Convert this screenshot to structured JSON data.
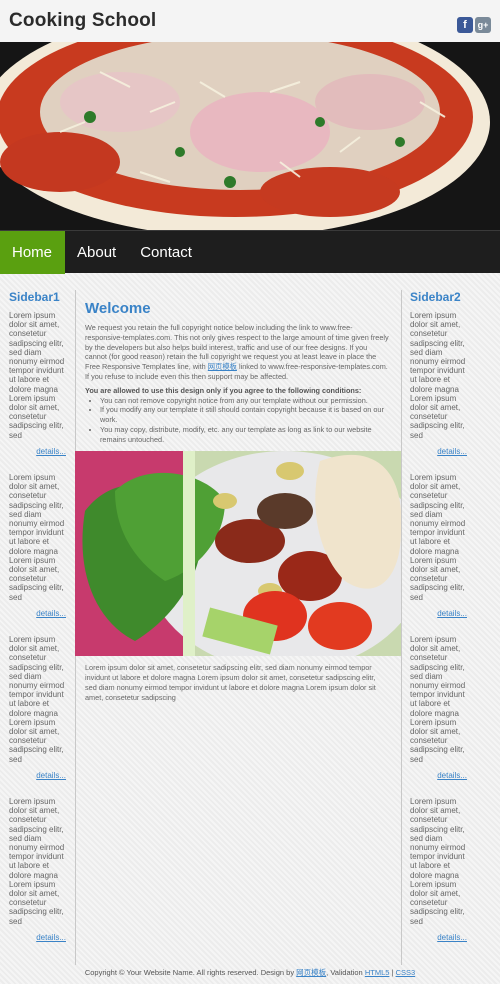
{
  "header": {
    "site_title": "Cooking School",
    "social": [
      {
        "label": "f",
        "icon": "facebook-icon"
      },
      {
        "label": "g+",
        "icon": "google-plus-icon"
      }
    ]
  },
  "nav": {
    "items": [
      "Home",
      "About",
      "Contact"
    ],
    "active": "Home",
    "active_color": "#5aa010"
  },
  "sidebar1": {
    "title": "Sidebar1",
    "blocks": [
      {
        "text": "Lorem ipsum dolor sit amet, consetetur sadipscing elitr, sed diam nonumy eirmod tempor invidunt ut labore et dolore magna Lorem ipsum dolor sit amet, consetetur sadipscing elitr, sed",
        "link": "details..."
      },
      {
        "text": "Lorem ipsum dolor sit amet, consetetur sadipscing elitr, sed diam nonumy eirmod tempor invidunt ut labore et dolore magna Lorem ipsum dolor sit amet, consetetur sadipscing elitr, sed",
        "link": "details..."
      },
      {
        "text": "Lorem ipsum dolor sit amet, consetetur sadipscing elitr, sed diam nonumy eirmod tempor invidunt ut labore et dolore magna Lorem ipsum dolor sit amet, consetetur sadipscing elitr, sed",
        "link": "details..."
      },
      {
        "text": "Lorem ipsum dolor sit amet, consetetur sadipscing elitr, sed diam nonumy eirmod tempor invidunt ut labore et dolore magna Lorem ipsum dolor sit amet, consetetur sadipscing elitr, sed",
        "link": "details..."
      }
    ]
  },
  "sidebar2": {
    "title": "Sidebar2",
    "blocks": [
      {
        "text": "Lorem ipsum dolor sit amet, consetetur sadipscing elitr, sed diam nonumy eirmod tempor invidunt ut labore et dolore magna Lorem ipsum dolor sit amet, consetetur sadipscing elitr, sed",
        "link": "details..."
      },
      {
        "text": "Lorem ipsum dolor sit amet, consetetur sadipscing elitr, sed diam nonumy eirmod tempor invidunt ut labore et dolore magna Lorem ipsum dolor sit amet, consetetur sadipscing elitr, sed",
        "link": "details..."
      },
      {
        "text": "Lorem ipsum dolor sit amet, consetetur sadipscing elitr, sed diam nonumy eirmod tempor invidunt ut labore et dolore magna Lorem ipsum dolor sit amet, consetetur sadipscing elitr, sed",
        "link": "details..."
      },
      {
        "text": "Lorem ipsum dolor sit amet, consetetur sadipscing elitr, sed diam nonumy eirmod tempor invidunt ut labore et dolore magna Lorem ipsum dolor sit amet, consetetur sadipscing elitr, sed",
        "link": "details..."
      }
    ]
  },
  "main": {
    "heading": "Welcome",
    "intro_before_link": "We request you retain the full copyright notice below including the link to www.free-responsive-templates.com. This not only gives respect to the large amount of time given freely by the developers but also helps build interest, traffic and use of our free designs. If you cannot (for good reason) retain the full copyright we request you at least leave in place the Free Responsive Templates line, with",
    "intro_link": "网页模板",
    "intro_after_link": "linked to www.free-responsive-templates.com. If you refuse to include even this then support may be affected.",
    "conditions_title": "You are allowed to use this design only if you agree to the following conditions:",
    "conditions": [
      "You can not remove copyright notice from any our template without our permission.",
      "If you modify any our template it still should contain copyright because it is based on our work.",
      "You may copy, distribute, modify, etc. any our template as long as link to our website remains untouched."
    ],
    "body_text": "Lorem ipsum dolor sit amet, consetetur sadipscing elitr, sed diam nonumy eirmod tempor invidunt ut labore et dolore magna Lorem ipsum dolor sit amet, consetetur sadipscing elitr, sed diam nonumy eirmod tempor invidunt ut labore et dolore magna Lorem ipsum dolor sit amet, consetetur sadipscing"
  },
  "footer": {
    "text_before": "Copyright © Your Website Name. All rights reserved. Design by",
    "design_link": "网页模板",
    "validation_label": ", Validation",
    "html5_link": "HTML5",
    "sep": "|",
    "css3_link": "CSS3"
  }
}
